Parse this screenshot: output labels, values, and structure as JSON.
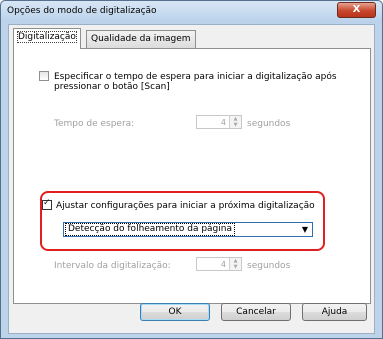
{
  "window": {
    "title": "Opções do modo de digitalização",
    "close_glyph": "X"
  },
  "tabs": [
    {
      "label": "Digitalização",
      "active": true
    },
    {
      "label": "Qualidade da imagem",
      "active": false
    }
  ],
  "wait_option": {
    "checked": false,
    "label_line1": "Especificar o tempo de espera para iniciar a digitalização após",
    "label_line2": "pressionar o botão [Scan]",
    "field_label": "Tempo de espera:",
    "value": "4",
    "unit": "segundos",
    "enabled": false
  },
  "next_scan_option": {
    "checked": true,
    "label": "Ajustar configurações para iniciar a próxima digitalização",
    "select_value": "Detecção do folheamento da página",
    "interval_label": "Intervalo da digitalização:",
    "interval_value": "4",
    "interval_unit": "segundos",
    "interval_enabled": false
  },
  "buttons": {
    "ok": "OK",
    "cancel": "Cancelar",
    "help": "Ajuda"
  },
  "colors": {
    "highlight": "#e02020",
    "close_button": "#c7472d"
  }
}
